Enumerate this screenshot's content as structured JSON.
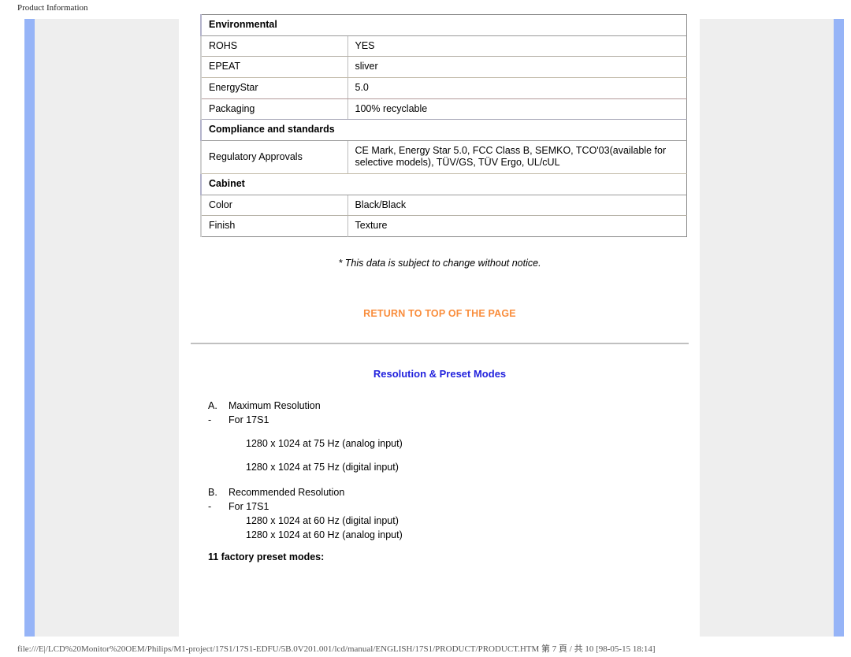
{
  "window": {
    "title": "Product Information",
    "status_text": "file:///E|/LCD%20Monitor%20OEM/Philips/M1-project/17S1/17S1-EDFU/5B.0V201.001/lcd/manual/ENGLISH/17S1/PRODUCT/PRODUCT.HTM 第 7 頁 / 共 10 [98-05-15 18:14]"
  },
  "colors": {
    "section_heading": "#2222dd",
    "link_orange": "#f98d3c",
    "panel_blue": "#96b4f7",
    "panel_grey": "#eeeeee"
  },
  "spec_table": {
    "sections": [
      {
        "heading": "Environmental",
        "rows": [
          {
            "label": "ROHS",
            "value": "YES"
          },
          {
            "label": "EPEAT",
            "value": "sliver"
          },
          {
            "label": "EnergyStar",
            "value": "5.0"
          },
          {
            "label": "Packaging",
            "value": "100% recyclable"
          }
        ]
      },
      {
        "heading": "Compliance and standards",
        "rows": [
          {
            "label": "Regulatory Approvals",
            "value": "CE Mark, Energy Star 5.0, FCC Class B, SEMKO, TCO'03(available for selective models), TÜV/GS, TÜV Ergo, UL/cUL"
          }
        ]
      },
      {
        "heading": "Cabinet",
        "rows": [
          {
            "label": "Color",
            "value": "Black/Black"
          },
          {
            "label": "Finish",
            "value": "Texture"
          }
        ]
      }
    ]
  },
  "footnote": "* This data is subject to change without notice.",
  "return_top_label": "RETURN TO TOP OF THE PAGE",
  "resolution": {
    "title": "Resolution & Preset Modes",
    "items": [
      {
        "marker": "A.",
        "text": "Maximum Resolution"
      },
      {
        "marker": "-",
        "text": "For 17S1"
      }
    ],
    "max_lines": [
      "1280 x 1024 at 75 Hz (analog input)",
      "1280 x 1024 at 75 Hz (digital input)"
    ],
    "items_b": [
      {
        "marker": "B.",
        "text": "Recommended Resolution"
      },
      {
        "marker": "-",
        "text": "For 17S1"
      }
    ],
    "rec_lines": [
      "1280 x 1024 at 60 Hz (digital input)",
      "1280 x 1024 at 60 Hz (analog input)"
    ],
    "preset_modes_title": "11 factory preset modes:"
  }
}
